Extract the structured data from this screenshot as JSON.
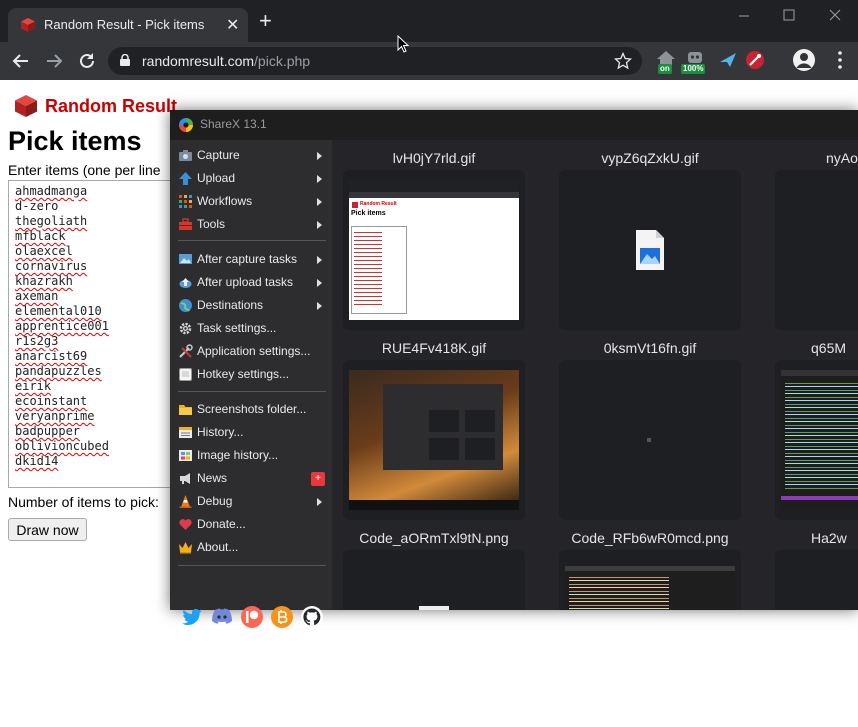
{
  "browser": {
    "tab_title": "Random Result - Pick items",
    "tab_close": "✕",
    "new_tab": "+",
    "url_host": "randomresult.com",
    "url_path": "/pick.php",
    "ext_badges": {
      "on": "on",
      "percent": "100%"
    }
  },
  "page": {
    "brand": "Random Result",
    "heading": "Pick items",
    "instruction": "Enter items (one per line",
    "items": [
      "ahmadmanga",
      "d-zero",
      "thegoliath",
      "mfblack",
      "olaexcel",
      "cornavirus",
      "khazrakh",
      "axeman",
      "elemental010",
      "apprentice001",
      "r1s2g3",
      "anarcist69",
      "pandapuzzles",
      "eirik",
      "ecoinstant",
      "veryanprime",
      "badpupper",
      "oblivioncubed",
      "dkid14"
    ],
    "count_label": "Number of items to pick:",
    "draw_button": "Draw now"
  },
  "sharex": {
    "title": "ShareX 13.1",
    "menu": [
      "Capture",
      "Upload",
      "Workflows",
      "Tools",
      "After capture tasks",
      "After upload tasks",
      "Destinations",
      "Task settings...",
      "Application settings...",
      "Hotkey settings...",
      "Screenshots folder...",
      "History...",
      "Image history...",
      "News",
      "Debug",
      "Donate...",
      "About..."
    ],
    "news_badge": "+",
    "files": [
      "lvH0jY7rld.gif",
      "vypZ6qZxkU.gif",
      "nyAo",
      "RUE4Fv418K.gif",
      "0ksmVt16fn.gif",
      "q65M",
      "Code_aORmTxl9tN.png",
      "Code_RFb6wR0mcd.png",
      "Ha2w"
    ],
    "mini_page": {
      "brand": "Random Result",
      "heading": "Pick items",
      "button": "Draw now"
    }
  }
}
